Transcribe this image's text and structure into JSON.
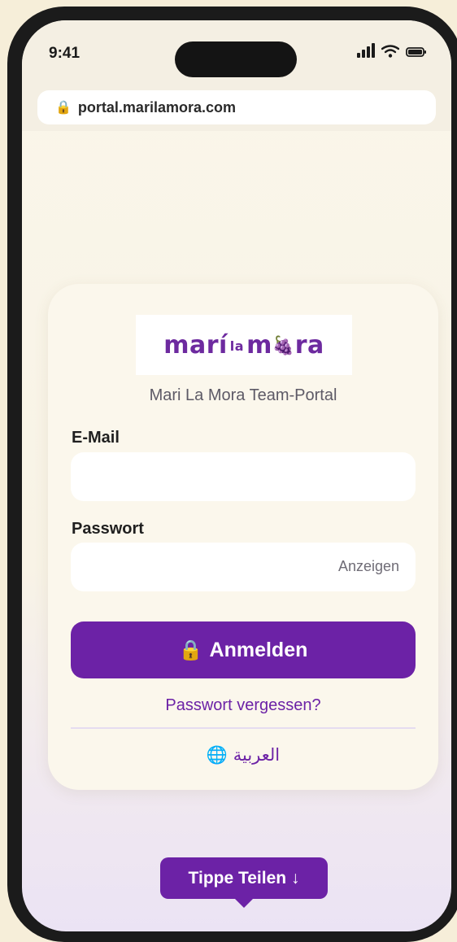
{
  "status_bar": {
    "time": "9:41"
  },
  "browser": {
    "url": "portal.marilamora.com"
  },
  "logo": {
    "part1": "marí",
    "part2": "la",
    "part3": "m",
    "part4": "ra",
    "berry_glyph": "🍇"
  },
  "portal": {
    "subtitle": "Mari La Mora Team-Portal",
    "email_label": "E-Mail",
    "email_value": "",
    "password_label": "Passwort",
    "password_value": "",
    "show_label": "Anzeigen",
    "login_label": "Anmelden",
    "forgot_label": "Passwort vergessen?",
    "language_label": "العربية"
  },
  "share_hint": "Tippe Teilen ↓",
  "colors": {
    "accent": "#6c22a6",
    "background": "#f6eed9",
    "card": "#fbf7ec"
  }
}
